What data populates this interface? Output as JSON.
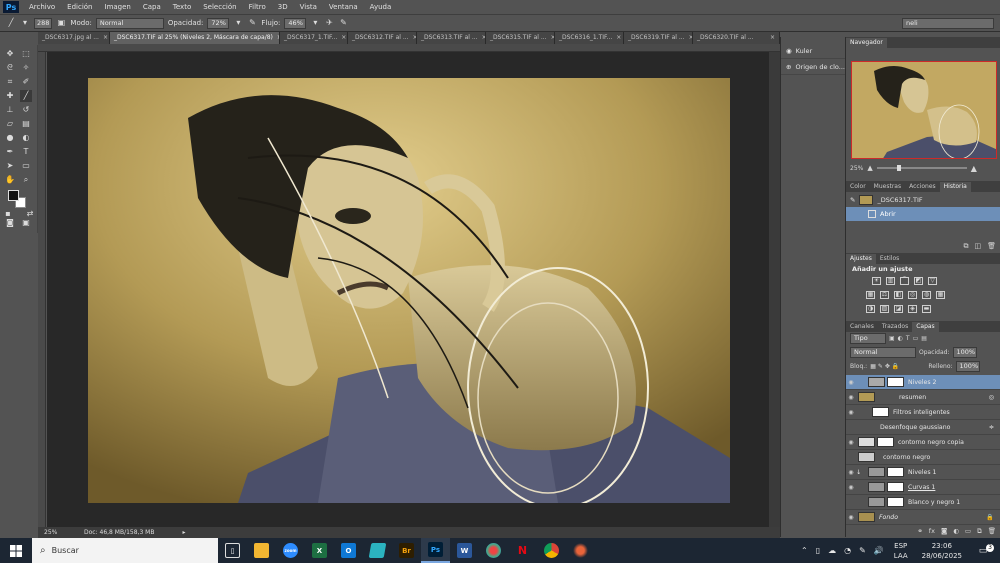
{
  "app": {
    "logo": "Ps",
    "icon": "photoshop-icon"
  },
  "menu": [
    "Archivo",
    "Edición",
    "Imagen",
    "Capa",
    "Texto",
    "Selección",
    "Filtro",
    "3D",
    "Vista",
    "Ventana",
    "Ayuda"
  ],
  "options": {
    "brush_size": "288",
    "mode_label": "Modo:",
    "mode_value": "Normal",
    "opacity_label": "Opacidad:",
    "opacity_value": "72%",
    "flow_label": "Flujo:",
    "flow_value": "46%",
    "workspace": "neli"
  },
  "tabs": [
    {
      "label": "_DSC6317.jpg al ...",
      "close": "×",
      "active": false
    },
    {
      "label": "_DSC6317.TIF al 25% (Niveles 2, Máscara de capa/8)",
      "close": "×",
      "active": true
    },
    {
      "label": "_DSC6317_1.TIF...",
      "close": "×",
      "active": false
    },
    {
      "label": "_DSC6312.TIF al ...",
      "close": "×",
      "active": false
    },
    {
      "label": "_DSC6313.TIF al ...",
      "close": "×",
      "active": false
    },
    {
      "label": "_DSC6315.TIF al ...",
      "close": "×",
      "active": false
    },
    {
      "label": "_DSC6316_1.TIF...",
      "close": "×",
      "active": false
    },
    {
      "label": "_DSC6319.TIF al ...",
      "close": "×",
      "active": false
    },
    {
      "label": "_DSC6320.TIF al ...",
      "close": "×",
      "active": false
    }
  ],
  "status": {
    "zoom": "25%",
    "doc": "Doc: 46,8 MB/158,3 MB"
  },
  "kuler": [
    {
      "label": "Kuler",
      "icon": "kuler-icon"
    },
    {
      "label": "Origen de clo...",
      "icon": "clone-source-icon"
    }
  ],
  "navigator": {
    "title": "Navegador",
    "zoom": "25%"
  },
  "history_tabs": [
    "Color",
    "Muestras",
    "Acciones",
    "Historia"
  ],
  "history": {
    "snapshot": "_DSC6317.TIF",
    "items": [
      "Abrir"
    ]
  },
  "adjust_tabs": [
    "Ajustes",
    "Estilos"
  ],
  "adjust_title": "Añadir un ajuste",
  "layers_tabs": [
    "Canales",
    "Trazados",
    "Capas"
  ],
  "layers": {
    "filter": "Tipo",
    "blend": "Normal",
    "opacity_label": "Opacidad:",
    "opacity": "100%",
    "lock_label": "Bloq.:",
    "fill_label": "Relleno:",
    "fill": "100%",
    "items": [
      {
        "name": "Niveles 2",
        "kind": "adjust",
        "selected": true,
        "visible": true
      },
      {
        "name": "resumen",
        "kind": "smart",
        "selected": false,
        "visible": true
      },
      {
        "name": "Filtros inteligentes",
        "kind": "filter-group",
        "selected": false,
        "visible": true
      },
      {
        "name": "Desenfoque gaussiano",
        "kind": "filter",
        "selected": false,
        "visible": false
      },
      {
        "name": "contorno negro copia",
        "kind": "pixel",
        "selected": false,
        "visible": true
      },
      {
        "name": "contorno negro",
        "kind": "pixel",
        "selected": false,
        "visible": false
      },
      {
        "name": "Niveles 1",
        "kind": "adjust",
        "selected": false,
        "visible": true
      },
      {
        "name": "Curvas 1",
        "kind": "adjust",
        "selected": false,
        "visible": true
      },
      {
        "name": "Blanco y negro 1",
        "kind": "adjust",
        "selected": false,
        "visible": false
      },
      {
        "name": "Fondo",
        "kind": "background",
        "selected": false,
        "visible": true
      }
    ]
  },
  "taskbar": {
    "search": "Buscar",
    "apps": [
      {
        "icon": "task-view-icon",
        "label": "",
        "color": "#1c2633"
      },
      {
        "icon": "file-explorer-icon",
        "label": "",
        "color": "#f2b632"
      },
      {
        "icon": "zoom-icon",
        "label": "zoom",
        "color": "#2d8cff"
      },
      {
        "icon": "excel-icon",
        "label": "X",
        "color": "#1d6f42"
      },
      {
        "icon": "outlook-icon",
        "label": "O",
        "color": "#0f78d4"
      },
      {
        "icon": "notes-icon",
        "label": "",
        "color": "#2bb3c0"
      },
      {
        "icon": "bridge-icon",
        "label": "Br",
        "color": "#2e1e00"
      },
      {
        "icon": "photoshop-icon",
        "label": "Ps",
        "color": "#001e36"
      },
      {
        "icon": "word-icon",
        "label": "W",
        "color": "#2b579a"
      },
      {
        "icon": "paint-icon",
        "label": "",
        "color": "#1c2633"
      },
      {
        "icon": "netflix-icon",
        "label": "N",
        "color": "#1c2633"
      },
      {
        "icon": "chrome-icon",
        "label": "",
        "color": "#1c2633"
      },
      {
        "icon": "splash-icon",
        "label": "",
        "color": "#1c2633"
      }
    ],
    "lang": "ESP",
    "layout": "LAA",
    "time": "23:06",
    "date": "28/06/2025",
    "notifications": "3"
  }
}
